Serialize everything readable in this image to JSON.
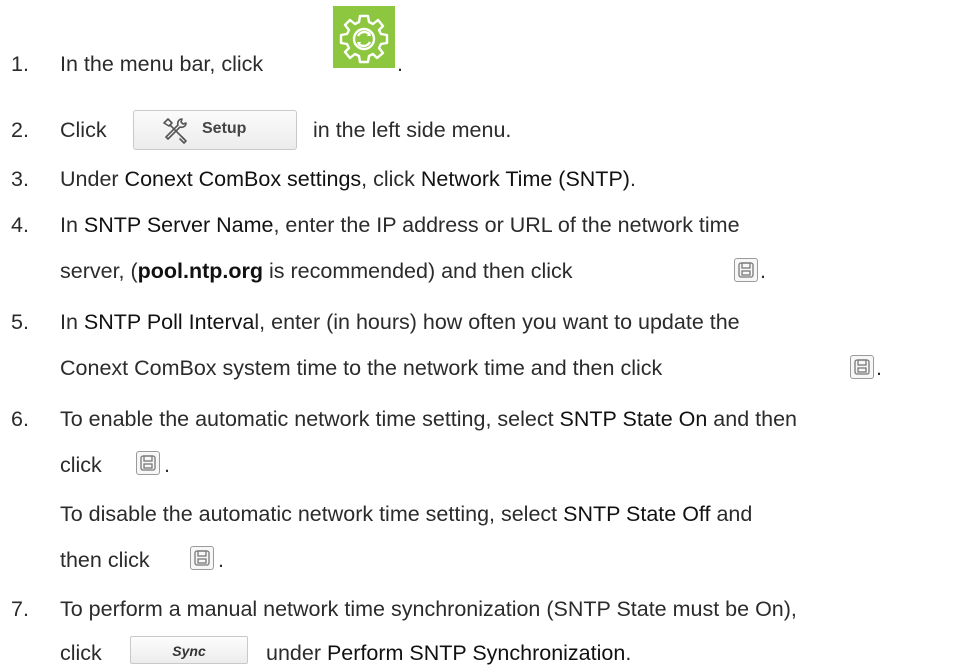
{
  "steps": [
    {
      "num": "1.",
      "pre": "In the menu bar, click",
      "post": "."
    },
    {
      "num": "2.",
      "pre": "Click",
      "button": "Setup",
      "post": "in the left side menu."
    },
    {
      "num": "3.",
      "a": "Under ",
      "b": "Conext ComBox settings",
      "c": ", click ",
      "d": "Network Time (SNTP)",
      "e": "."
    },
    {
      "num": "4.",
      "a": "In ",
      "b": "SNTP Server Name",
      "c": ", enter the IP address or URL of the network time",
      "d": "server, (",
      "e": "pool.ntp.org",
      "f": " is recommended) and then click",
      "g": "."
    },
    {
      "num": "5.",
      "a": "In ",
      "b": "SNTP Poll Interva",
      "c": "l, enter (in hours) how often you want to update the",
      "d": "Conext ComBox system time to the network time and then click",
      "e": "."
    },
    {
      "num": "6.",
      "a": "To enable the automatic network time setting, select ",
      "b": "SNTP State On",
      "c": " and then",
      "d": "click",
      "e": ".",
      "f": "To disable the automatic network time setting, select ",
      "g": "SNTP State Off",
      "h": " and",
      "i": "then click",
      "j": "."
    },
    {
      "num": "7.",
      "a": "To perform a manual network time synchronization (SNTP State must be On),",
      "b": "click",
      "button": "Sync",
      "c": "under ",
      "d": "Perform SNTP Synchronization",
      "e": "."
    }
  ],
  "colors": {
    "gear_tile": "#8dc63f",
    "text": "#2b2b2b"
  },
  "icons": {
    "step1": "gear-icon",
    "step2": "tools-icon",
    "save": "save-icon"
  }
}
